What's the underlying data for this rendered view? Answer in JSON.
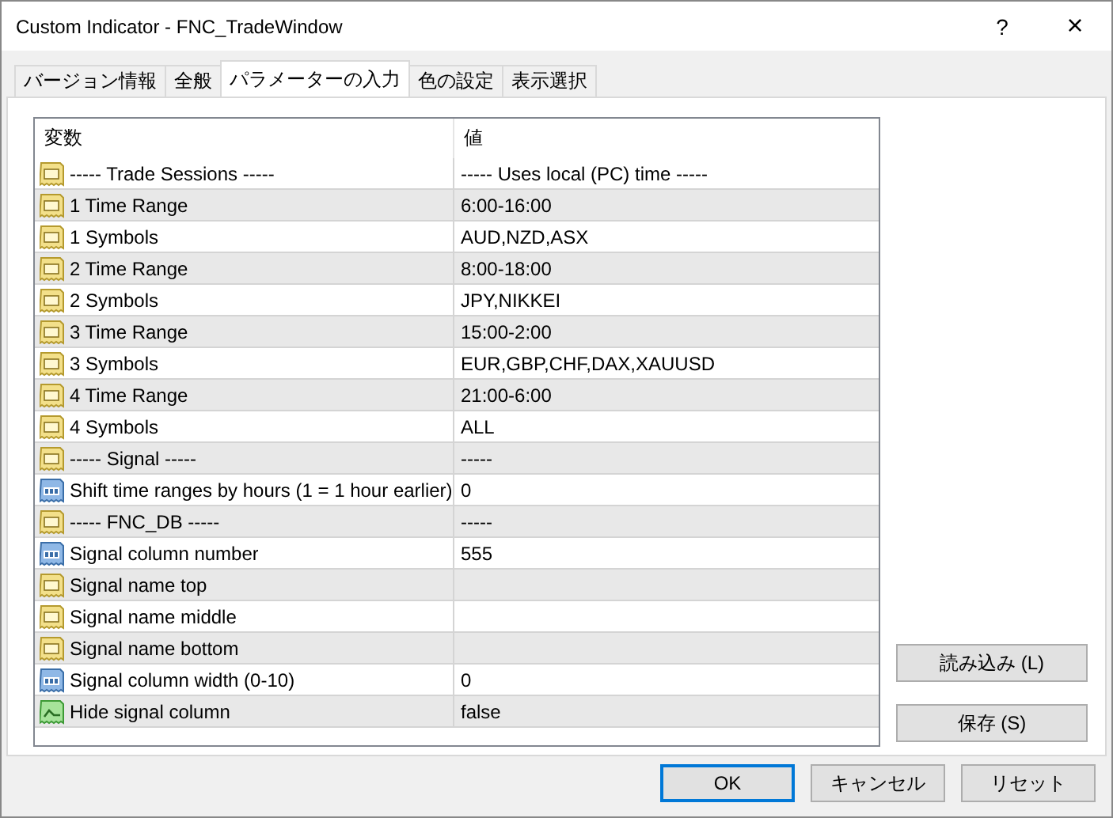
{
  "window": {
    "title": "Custom Indicator - FNC_TradeWindow",
    "help": "?",
    "close": "×"
  },
  "tabs": [
    {
      "label": "バージョン情報",
      "selected": false
    },
    {
      "label": "全般",
      "selected": false
    },
    {
      "label": "パラメーターの入力",
      "selected": true
    },
    {
      "label": "色の設定",
      "selected": false
    },
    {
      "label": "表示選択",
      "selected": false
    }
  ],
  "table": {
    "columns": [
      "変数",
      "値"
    ],
    "rows": [
      {
        "kind": "text",
        "name": "----- Trade Sessions -----",
        "value": "----- Uses local (PC) time -----"
      },
      {
        "kind": "text",
        "name": "1 Time Range",
        "value": "6:00-16:00"
      },
      {
        "kind": "text",
        "name": "1 Symbols",
        "value": "AUD,NZD,ASX"
      },
      {
        "kind": "text",
        "name": "2 Time Range",
        "value": "8:00-18:00"
      },
      {
        "kind": "text",
        "name": "2 Symbols",
        "value": "JPY,NIKKEI"
      },
      {
        "kind": "text",
        "name": "3 Time Range",
        "value": "15:00-2:00"
      },
      {
        "kind": "text",
        "name": "3 Symbols",
        "value": "EUR,GBP,CHF,DAX,XAUUSD"
      },
      {
        "kind": "text",
        "name": "4 Time Range",
        "value": "21:00-6:00"
      },
      {
        "kind": "text",
        "name": "4 Symbols",
        "value": "ALL"
      },
      {
        "kind": "text",
        "name": "----- Signal -----",
        "value": "-----"
      },
      {
        "kind": "number",
        "name": "Shift time ranges by hours (1 = 1 hour earlier)",
        "value": "0"
      },
      {
        "kind": "text",
        "name": "----- FNC_DB -----",
        "value": "-----"
      },
      {
        "kind": "number",
        "name": "Signal column number",
        "value": "555"
      },
      {
        "kind": "text",
        "name": "Signal name top"
      },
      {
        "kind": "text",
        "name": "Signal name middle"
      },
      {
        "kind": "text",
        "name": "Signal name bottom"
      },
      {
        "kind": "number",
        "name": "Signal column width (0-10)",
        "value": "0"
      },
      {
        "kind": "bool",
        "name": "Hide signal column",
        "value": "false"
      }
    ]
  },
  "side_buttons": [
    "読み込み (L)",
    "保存 (S)"
  ],
  "buttons": [
    {
      "label": "OK",
      "selected": true
    },
    {
      "label": "キャンセル",
      "selected": false
    },
    {
      "label": "リセット",
      "selected": false
    }
  ]
}
